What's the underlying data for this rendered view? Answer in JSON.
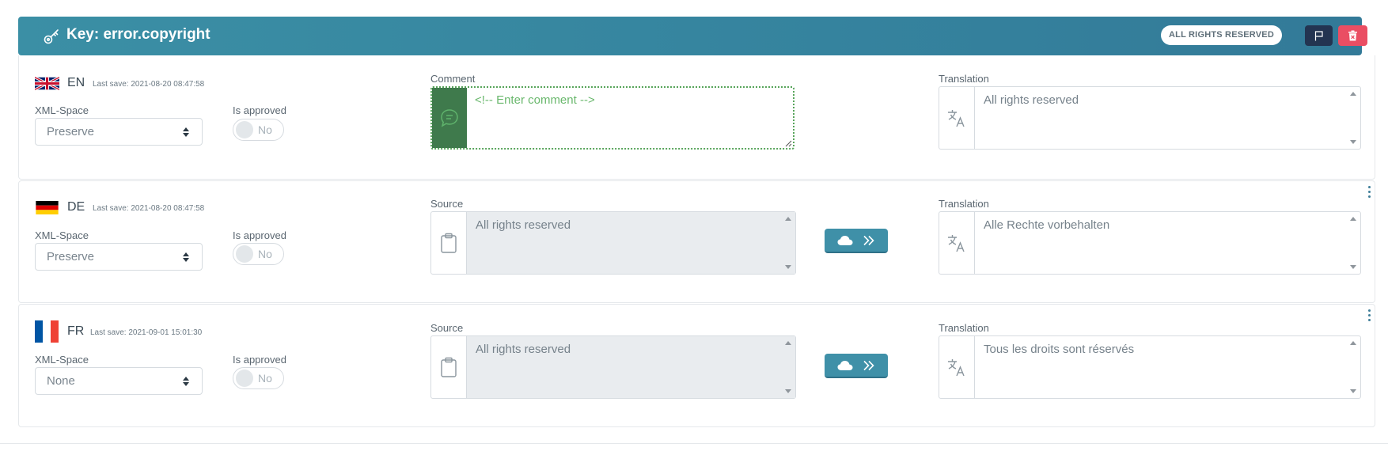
{
  "header": {
    "key_prefix": "Key:",
    "key_name": "error.copyright",
    "badge": "ALL RIGHTS RESERVED",
    "flag_icon": "flag-icon",
    "delete_icon": "trash-icon",
    "colors": {
      "header": "#3b8fa5",
      "flag_button": "#233451",
      "delete_button": "#ea4e63"
    }
  },
  "rows": [
    {
      "lang": "EN",
      "last_save": "Last save: 2021-08-20 08:47:58",
      "xml_space_label": "XML-Space",
      "xml_space_value": "Preserve",
      "approved_label": "Is approved",
      "approved_value": "No",
      "middle_label": "Comment",
      "comment_placeholder": "<!-- Enter comment -->",
      "translation_label": "Translation",
      "translation": "All rights reserved"
    },
    {
      "lang": "DE",
      "last_save": "Last save: 2021-08-20 08:47:58",
      "xml_space_label": "XML-Space",
      "xml_space_value": "Preserve",
      "approved_label": "Is approved",
      "approved_value": "No",
      "middle_label": "Source",
      "source": "All rights reserved",
      "translation_label": "Translation",
      "translation": "Alle Rechte vorbehalten"
    },
    {
      "lang": "FR",
      "last_save": "Last save: 2021-09-01 15:01:30",
      "xml_space_label": "XML-Space",
      "xml_space_value": "None",
      "approved_label": "Is approved",
      "approved_value": "No",
      "middle_label": "Source",
      "source": "All rights reserved",
      "translation_label": "Translation",
      "translation": "Tous les droits sont réservés"
    }
  ]
}
